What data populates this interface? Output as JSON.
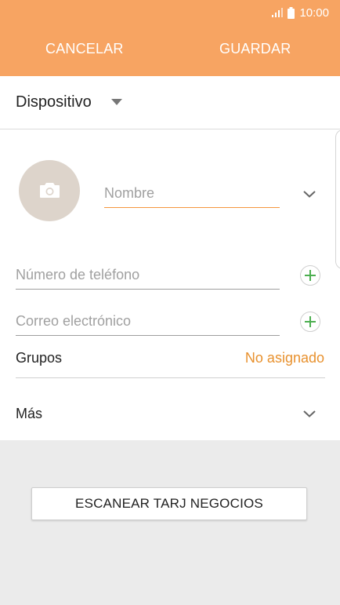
{
  "status_bar": {
    "time": "10:00",
    "icons": [
      "signal-icon",
      "battery-icon"
    ]
  },
  "action_bar": {
    "cancel_label": "CANCELAR",
    "save_label": "GUARDAR",
    "background_color": "#f7a462"
  },
  "account": {
    "label": "Dispositivo"
  },
  "form": {
    "name_placeholder": "Nombre",
    "phone_placeholder": "Número de teléfono",
    "email_placeholder": "Correo electrónico",
    "groups_label": "Grupos",
    "groups_value": "No asignado",
    "more_label": "Más",
    "accent_color": "#f5963e",
    "add_icon_color": "#4caf50"
  },
  "scan_button": {
    "label": "ESCANEAR TARJ NEGOCIOS"
  }
}
